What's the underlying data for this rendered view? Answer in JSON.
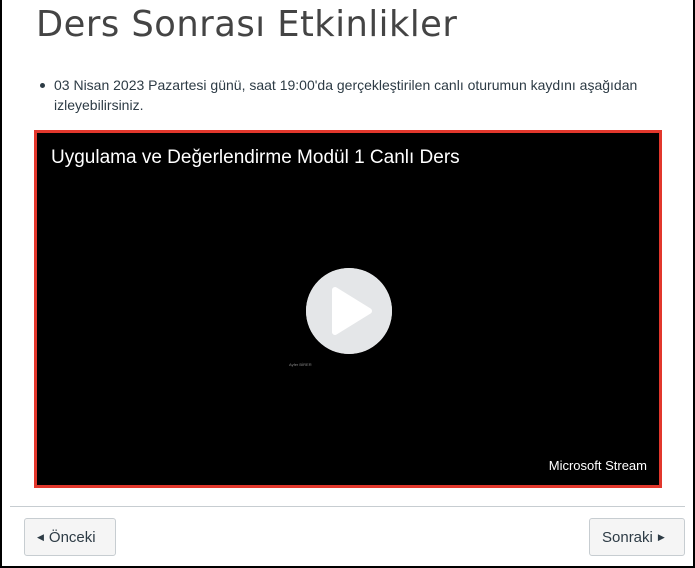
{
  "page": {
    "title": "Ders Sonrası Etkinlikler",
    "bullets": [
      "03 Nisan 2023 Pazartesi günü, saat 19:00'da gerçekleştirilen canlı oturumun kaydını aşağıdan izleyebilirsiniz."
    ]
  },
  "video": {
    "title": "Uygulama ve Değerlendirme Modül 1 Canlı Ders",
    "caption": "Ayfer BİRER",
    "brand": "Microsoft Stream",
    "play_icon": "play-icon",
    "border_color": "#e2372c"
  },
  "nav": {
    "prev_label": "Önceki",
    "next_label": "Sonraki",
    "prev_icon": "triangle-left-icon",
    "next_icon": "triangle-right-icon"
  }
}
